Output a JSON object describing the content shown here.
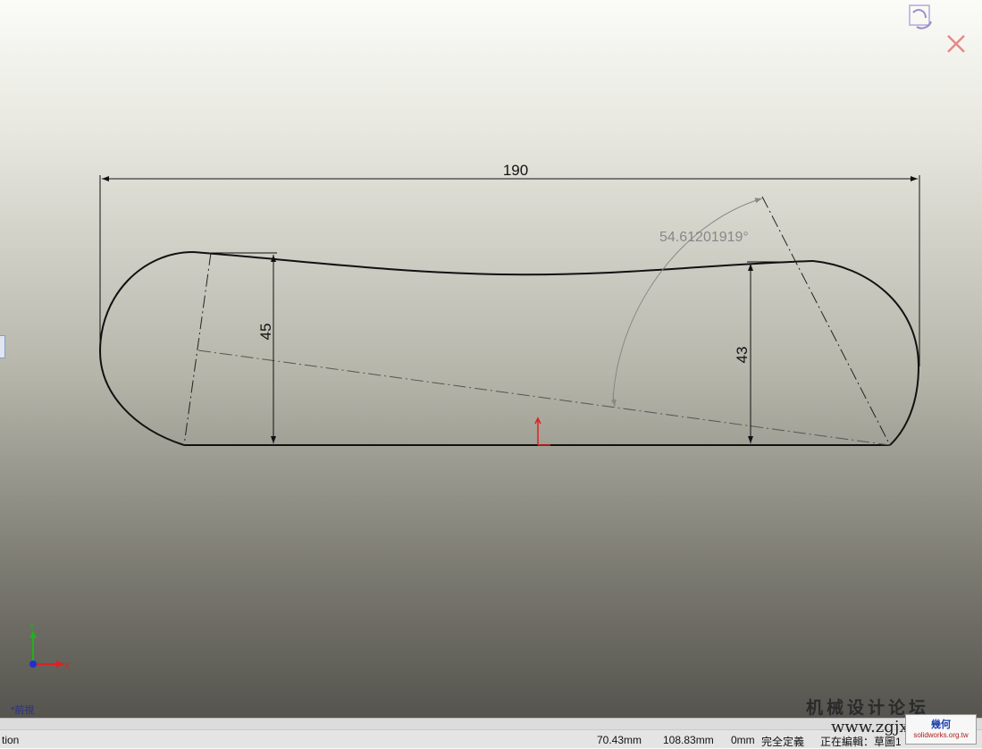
{
  "window": {
    "rebuild_icon": "rebuild-icon",
    "close_icon": "close-icon"
  },
  "sketch": {
    "dim_width": "190",
    "dim_left_height": "45",
    "dim_right_height": "43",
    "dim_angle": "54.61201919°"
  },
  "view": {
    "label": "*前視"
  },
  "status": {
    "left": "tion",
    "x": "70.43mm",
    "y": "108.83mm",
    "z": "0mm",
    "define_state": "完全定義",
    "editing": "正在編輯：",
    "editing_target": "草圖1"
  },
  "watermark": {
    "brand": "机械设计论坛",
    "url": "www.zgjxcad.com",
    "badge_title": "幾何",
    "badge_url": "solidworks.org.tw"
  },
  "colors": {
    "sketch_line": "#111111",
    "origin_red": "#e02020",
    "triad_x": "#e02020",
    "triad_y": "#20b020",
    "triad_z": "#2030d0"
  }
}
